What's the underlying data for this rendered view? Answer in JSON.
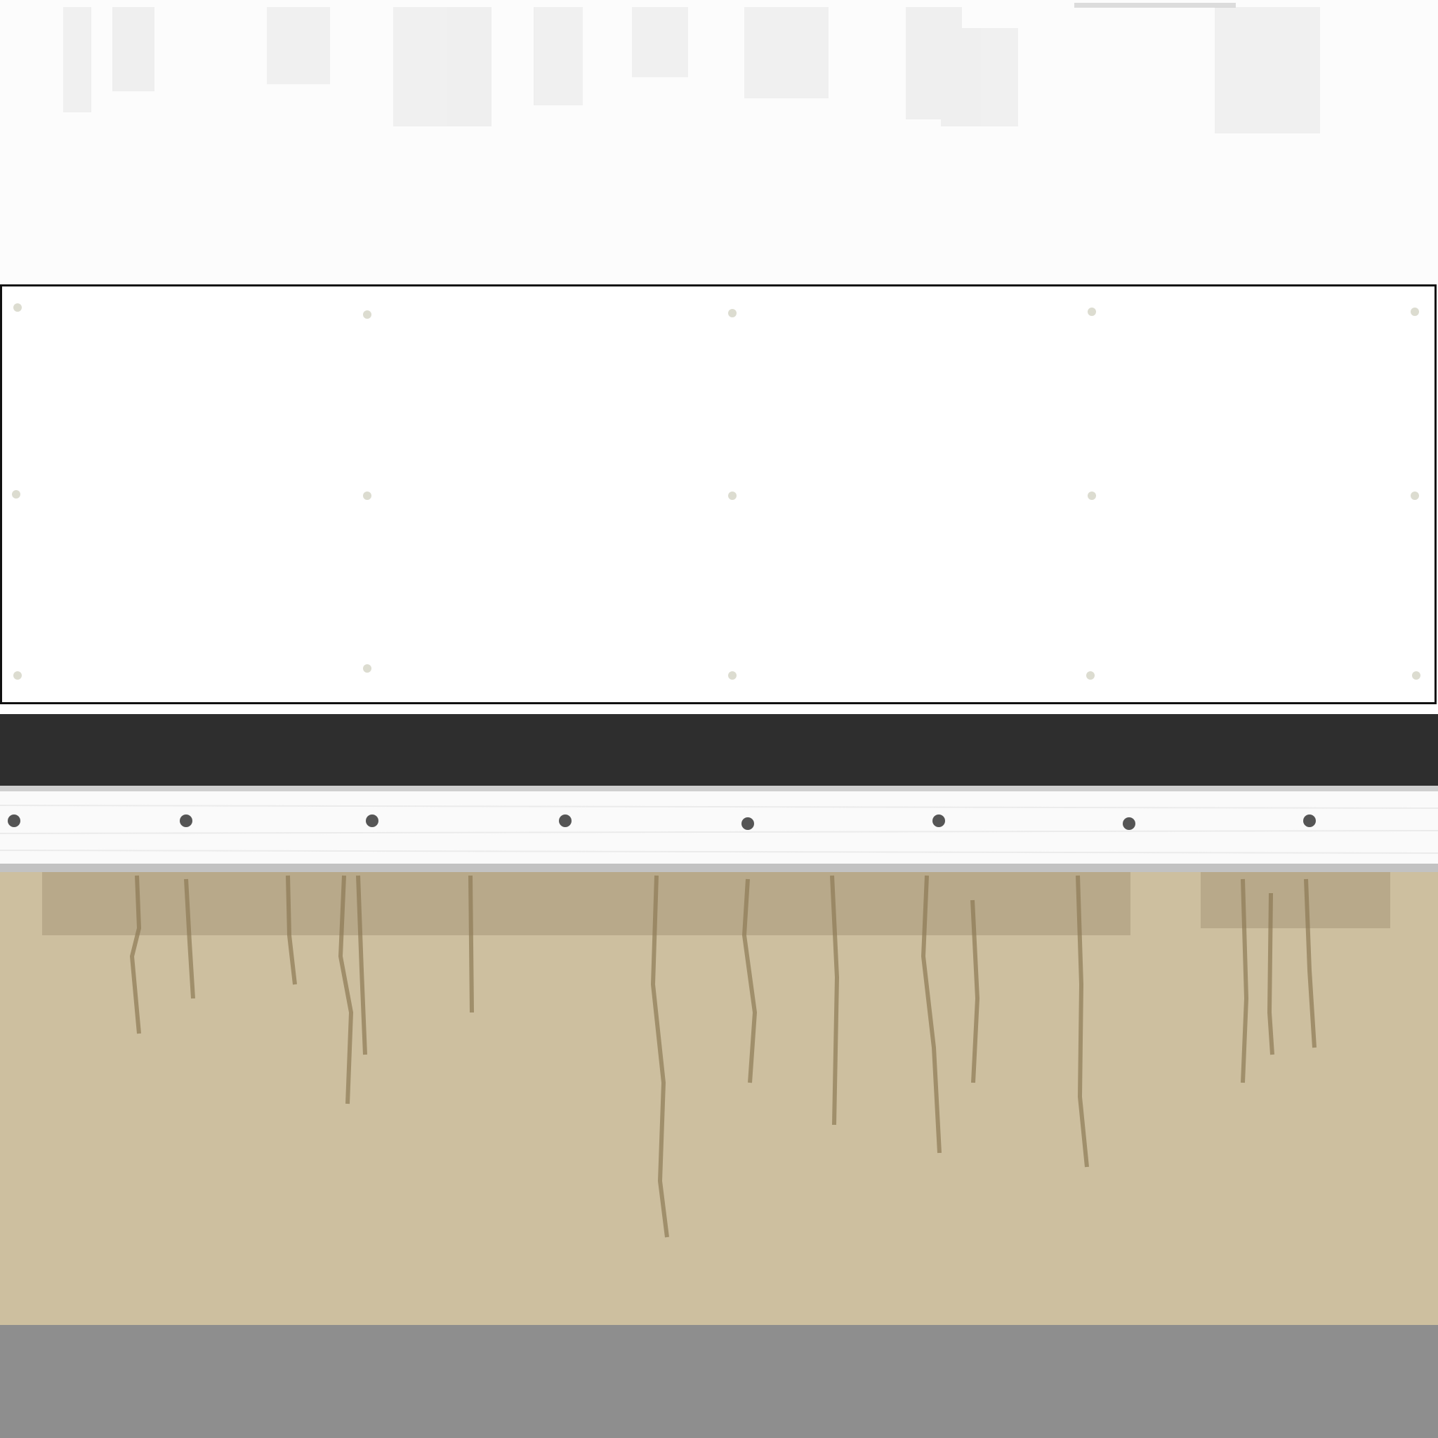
{
  "colors": {
    "top_band": "#fcfcfc",
    "panel_fill": "#ffffff",
    "panel_border": "#111111",
    "dark_stripe": "#2e2e2e",
    "trim_edge_light": "#cfcfcf",
    "trim_board": "#fafafa",
    "trim_edge_dark": "#c2c2c2",
    "stucco": "#cdbf9f",
    "stain": "#8d7a55",
    "concrete": "#8e8e8e",
    "panel_dot": "#dcdcd0",
    "trim_dot": "#555555"
  },
  "icons": {
    "panel_fastener": "panel-fastener-icon",
    "trim_nail": "trim-nail-icon"
  }
}
